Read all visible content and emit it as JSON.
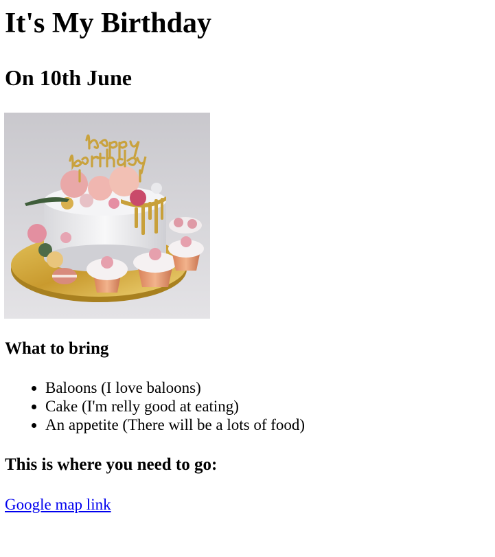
{
  "page": {
    "title": "It's My Birthday",
    "date": "On 10th June"
  },
  "image": {
    "topper_text_line1": "happy",
    "topper_text_line2": "birthday",
    "icon": "birthday-cake-photo"
  },
  "bring": {
    "heading": "What to bring",
    "items": [
      "Baloons (I love baloons)",
      "Cake (I'm relly good at eating)",
      "An appetite (There will be a lots of food)"
    ]
  },
  "location": {
    "heading": "This is where you need to go:",
    "link_text": "Google map link"
  },
  "colors": {
    "link": "#0000ee",
    "text": "#000000",
    "background": "#ffffff"
  }
}
